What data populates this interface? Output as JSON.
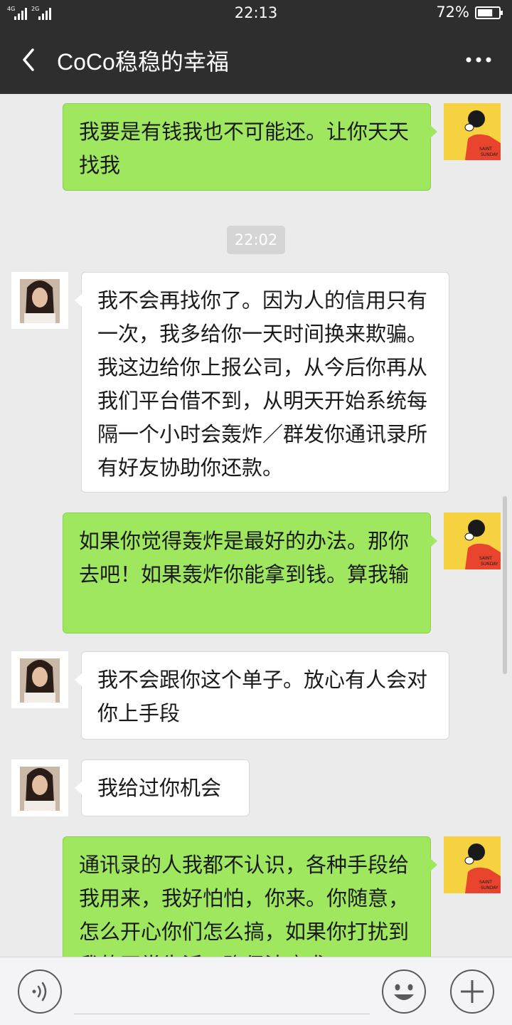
{
  "status_bar": {
    "net_labels": [
      "4G",
      "2G"
    ],
    "time": "22:13",
    "battery": "72%",
    "battery_level": 0.72
  },
  "header": {
    "back_icon": "chevron-left-icon",
    "title": "CoCo稳稳的幸福",
    "more_icon": "more-dots-icon"
  },
  "messages": [
    {
      "side": "out",
      "text": "我要是有钱我也不可能还。让你天天找我"
    },
    {
      "side": "time",
      "text": "22:02"
    },
    {
      "side": "in",
      "text": "我不会再找你了。因为人的信用只有一次，我多给你一天时间换来欺骗。我这边给你上报公司，从今后你再从我们平台借不到，从明天开始系统每隔一个小时会轰炸／群发你通讯录所有好友协助你还款。"
    },
    {
      "side": "out",
      "text": "如果你觉得轰炸是最好的办法。那你去吧！如果轰炸你能拿到钱。算我输"
    },
    {
      "side": "in",
      "text": "我不会跟你这个单子。放心有人会对你上手段"
    },
    {
      "side": "in",
      "text": "我给过你机会"
    },
    {
      "side": "out",
      "text": "通讯录的人我都不认识，各种手段给我用来，我好怕怕，你来。你随意，怎么开心你们怎么搞，如果你打扰到我的正常生活，确保法庭求"
    }
  ],
  "input_bar": {
    "voice_icon": "voice-icon",
    "emoji_icon": "emoji-icon",
    "plus_icon": "plus-icon",
    "placeholder": ""
  },
  "colors": {
    "header_bg": "#2e2e2e",
    "chat_bg": "#ebebeb",
    "outgoing_bubble": "#9fe75e",
    "incoming_bubble": "#ffffff"
  }
}
